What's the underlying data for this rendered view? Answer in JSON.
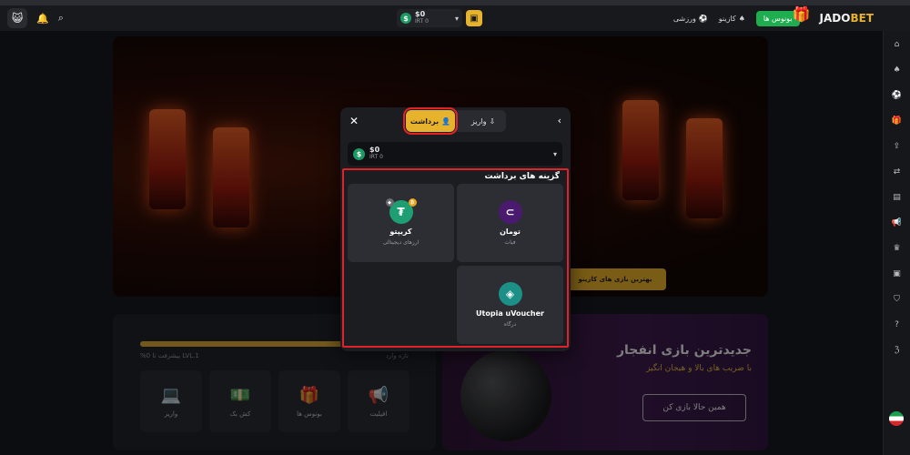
{
  "topbar": {
    "wallet_amount": "$0",
    "wallet_sub": "IRT 0",
    "sports_label": "ورزشی",
    "casino_label": "کازینو",
    "bonus_label": "بونوس ها",
    "logo_prefix": "JADO",
    "logo_suffix": "BET"
  },
  "banner": {
    "cta_label": "بهترین بازی های کازینو"
  },
  "progress": {
    "fraction": 0.98,
    "left_label": "%0 پیشرفت تا LVL.1",
    "right_label": "تازه وارد"
  },
  "quick_tiles": [
    {
      "label": "واریز",
      "icon": "laptop-icon"
    },
    {
      "label": "کش بک",
      "icon": "cash-hand-icon"
    },
    {
      "label": "بونوس ها",
      "icon": "gift-icon"
    },
    {
      "label": "افیلیت",
      "icon": "megaphone-icon"
    }
  ],
  "promo": {
    "title": "جدیدترین بازی انفجار",
    "subtitle": "با ضریب های بالا و هیجان انگیز",
    "button": "همین حالا بازی کن"
  },
  "modal": {
    "close_glyph": "✕",
    "back_glyph": "‹",
    "withdraw_tab": "برداشت",
    "deposit_tab": "واریز",
    "wallet_amount": "$0",
    "wallet_sub": "IRT 0",
    "options_title": "گزینه های برداشت",
    "options": [
      {
        "name": "تومان",
        "desc": "فیات",
        "icon": "toman-icon",
        "color": "#4a1a6e"
      },
      {
        "name": "کریپتو",
        "desc": "ارزهای دیجیتالی",
        "icon": "tether-icon",
        "color": "#1e9f73"
      },
      {
        "name": "Utopia uVoucher",
        "desc": "درگاه",
        "icon": "utopia-icon",
        "color": "#1c8f86"
      }
    ]
  },
  "colors": {
    "accent": "#e8b32c",
    "highlight": "#e0232a",
    "green": "#1fae4f"
  }
}
